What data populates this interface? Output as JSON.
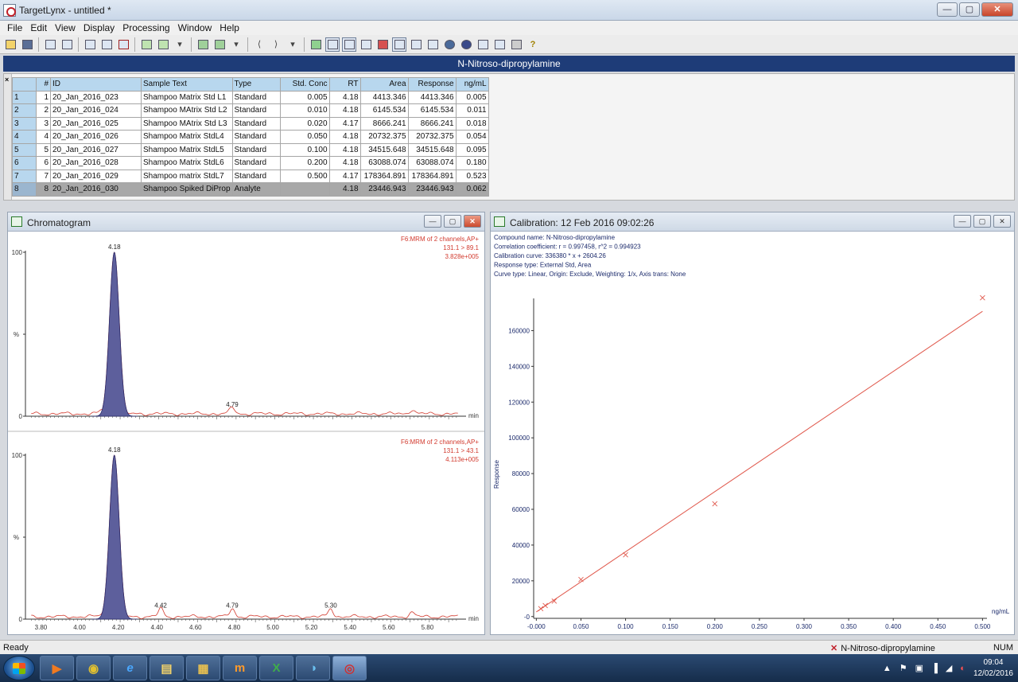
{
  "window": {
    "title": "TargetLynx - untitled *",
    "min": "—",
    "max": "▢",
    "close": "✕"
  },
  "menu": [
    "File",
    "Edit",
    "View",
    "Display",
    "Processing",
    "Window",
    "Help"
  ],
  "compound_header": "N-Nitroso-dipropylamine",
  "table": {
    "columns": [
      "",
      "#",
      "ID",
      "Sample Text",
      "Type",
      "Std. Conc",
      "RT",
      "Area",
      "Response",
      "ng/mL"
    ],
    "rows": [
      [
        "1",
        "1",
        "20_Jan_2016_023",
        "Shampoo Matrix Std L1",
        "Standard",
        "0.005",
        "4.18",
        "4413.346",
        "4413.346",
        "0.005"
      ],
      [
        "2",
        "2",
        "20_Jan_2016_024",
        "Shampoo MAtrix Std L2",
        "Standard",
        "0.010",
        "4.18",
        "6145.534",
        "6145.534",
        "0.011"
      ],
      [
        "3",
        "3",
        "20_Jan_2016_025",
        "Shampoo MAtrix Std L3",
        "Standard",
        "0.020",
        "4.17",
        "8666.241",
        "8666.241",
        "0.018"
      ],
      [
        "4",
        "4",
        "20_Jan_2016_026",
        "Shampoo Matrix StdL4",
        "Standard",
        "0.050",
        "4.18",
        "20732.375",
        "20732.375",
        "0.054"
      ],
      [
        "5",
        "5",
        "20_Jan_2016_027",
        "Shampoo Matrix StdL5",
        "Standard",
        "0.100",
        "4.18",
        "34515.648",
        "34515.648",
        "0.095"
      ],
      [
        "6",
        "6",
        "20_Jan_2016_028",
        "Shampoo Matrix StdL6",
        "Standard",
        "0.200",
        "4.18",
        "63088.074",
        "63088.074",
        "0.180"
      ],
      [
        "7",
        "7",
        "20_Jan_2016_029",
        "Shampoo matrix StdL7",
        "Standard",
        "0.500",
        "4.17",
        "178364.891",
        "178364.891",
        "0.523"
      ],
      [
        "8",
        "8",
        "20_Jan_2016_030",
        "Shampoo Spiked DiProp",
        "Analyte",
        "",
        "4.18",
        "23446.943",
        "23446.943",
        "0.062"
      ]
    ],
    "selected_row": 7
  },
  "chromatogram": {
    "title": "Chromatogram",
    "panels": [
      {
        "header": [
          "F6:MRM of 2 channels,AP+",
          "131.1 > 89.1",
          "3.828e+005"
        ],
        "y_labels": [
          "100",
          "%",
          "0"
        ],
        "peaks": [
          {
            "rt": 4.18,
            "height": 100,
            "label": "4.18",
            "filled": true
          },
          {
            "rt": 4.79,
            "height": 4,
            "label": "4.79",
            "filled": false
          }
        ],
        "x_unit": "min"
      },
      {
        "header": [
          "F6:MRM of 2 channels,AP+",
          "131.1 > 43.1",
          "4.113e+005"
        ],
        "y_labels": [
          "100",
          "%",
          "0"
        ],
        "peaks": [
          {
            "rt": 4.18,
            "height": 100,
            "label": "4.18",
            "filled": true
          },
          {
            "rt": 4.42,
            "height": 5,
            "label": "4.42",
            "filled": false
          },
          {
            "rt": 4.79,
            "height": 5,
            "label": "4.79",
            "filled": false
          },
          {
            "rt": 5.3,
            "height": 5,
            "label": "5.30",
            "filled": false
          }
        ],
        "x_unit": "min"
      }
    ],
    "x_ticks": [
      "3.80",
      "4.00",
      "4.20",
      "4.40",
      "4.60",
      "4.80",
      "5.00",
      "5.20",
      "5.40",
      "5.60",
      "5.80"
    ],
    "x_range": [
      3.72,
      6.0
    ],
    "trace_color": "#d23a2e",
    "fill_color": "#5d5f9c"
  },
  "calibration": {
    "title": "Calibration: 12 Feb 2016 09:02:26",
    "info": [
      "Compound name: N-Nitroso-dipropylamine",
      "Correlation coefficient: r = 0.997458, r^2 = 0.994923",
      "Calibration curve: 336380 * x + 2604.26",
      "Response type: External Std, Area",
      "Curve type: Linear, Origin: Exclude, Weighting: 1/x, Axis trans: None"
    ],
    "ylabel": "Response",
    "xlabel": "ng/mL",
    "line_color": "#e0584c"
  },
  "chart_data": {
    "type": "scatter",
    "title": "Calibration: 12 Feb 2016 09:02:26",
    "xlabel": "ng/mL",
    "ylabel": "Response",
    "x_ticks": [
      "-0.000",
      "0.050",
      "0.100",
      "0.150",
      "0.200",
      "0.250",
      "0.300",
      "0.350",
      "0.400",
      "0.450",
      "0.500"
    ],
    "y_ticks": [
      "-0",
      "20000",
      "40000",
      "60000",
      "80000",
      "100000",
      "120000",
      "140000",
      "160000"
    ],
    "xlim": [
      -0.003,
      0.505
    ],
    "ylim": [
      -1000,
      178000
    ],
    "points": [
      {
        "x": 0.005,
        "y": 4413.346
      },
      {
        "x": 0.01,
        "y": 6145.534
      },
      {
        "x": 0.02,
        "y": 8666.241
      },
      {
        "x": 0.05,
        "y": 20732.375
      },
      {
        "x": 0.1,
        "y": 34515.648
      },
      {
        "x": 0.2,
        "y": 63088.074
      },
      {
        "x": 0.5,
        "y": 178364.891
      }
    ],
    "fit": {
      "slope": 336380,
      "intercept": 2604.26,
      "x_range": [
        0.0,
        0.5
      ]
    }
  },
  "status": {
    "ready": "Ready",
    "compound": "N-Nitroso-dipropylamine",
    "num": "NUM"
  },
  "taskbar": {
    "apps": [
      "▶",
      "◉",
      "e",
      "▤",
      "▦",
      "m",
      "X",
      "◑",
      "◎"
    ],
    "tray_symbols": [
      "▲",
      "⚑",
      "▣",
      "▐",
      "◢",
      "◐"
    ],
    "time": "09:04",
    "date": "12/02/2016"
  }
}
